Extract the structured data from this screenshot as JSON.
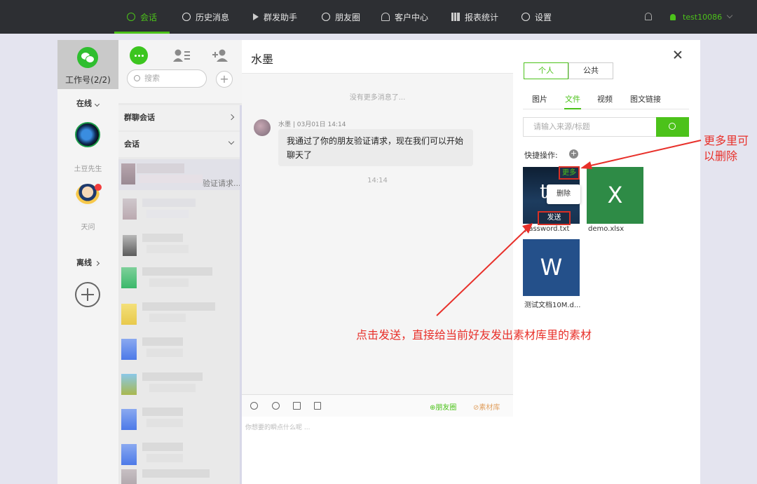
{
  "nav": {
    "items": [
      {
        "label": "会话",
        "icon": "chat-icon",
        "active": true
      },
      {
        "label": "历史消息",
        "icon": "clock-icon",
        "active": false
      },
      {
        "label": "群发助手",
        "icon": "send-icon",
        "active": false
      },
      {
        "label": "朋友圈",
        "icon": "aperture-icon",
        "active": false
      },
      {
        "label": "客户中心",
        "icon": "person-icon",
        "active": false
      },
      {
        "label": "报表统计",
        "icon": "bar-chart-icon",
        "active": false
      },
      {
        "label": "设置",
        "icon": "gear-icon",
        "active": false
      }
    ],
    "username": "test10086",
    "accent_color": "#4cc21a",
    "bar_color": "#2d2f33"
  },
  "rail": {
    "account_label": "工作号(2/2)",
    "online_label": "在线",
    "offline_label": "离线",
    "contacts": [
      {
        "name": "土豆先生"
      },
      {
        "name": "天问"
      }
    ]
  },
  "sessions": {
    "search_placeholder": "搜索",
    "add_label": "+",
    "group_section": "群聊会话",
    "session_section": "会话",
    "preview_partial": "验证请求..."
  },
  "chat": {
    "title": "水墨",
    "no_more": "没有更多消息了...",
    "message_meta": "水墨 | 03月01日 14:14",
    "message_text": "我通过了你的朋友验证请求，现在我们可以开始聊天了",
    "time_divider": "14:14",
    "moments_link": "⊕朋友圈",
    "material_link": "⊘素材库",
    "input_placeholder": "你想要的瞬点什么呢 ..."
  },
  "panel": {
    "scope_tabs": [
      "个人",
      "公共"
    ],
    "type_tabs": [
      "图片",
      "文件",
      "视频",
      "图文链接"
    ],
    "active_type": "文件",
    "filter_placeholder": "请输入来源/标题",
    "quick_ops_label": "快捷操作:",
    "more_label": "更多",
    "delete_label": "删除",
    "send_label": "发送",
    "files": [
      {
        "name": "password.txt",
        "letter": "t"
      },
      {
        "name": "demo.xlsx",
        "letter": "X",
        "color": "#2e8b46"
      },
      {
        "name": "测试文档10M.d...",
        "letter": "W",
        "color": "#24508a"
      }
    ]
  },
  "annotations": {
    "more_note": "更多里可以删除",
    "send_note": "点击发送，直接给当前好友发出素材库里的素材",
    "color": "#e8302a"
  }
}
